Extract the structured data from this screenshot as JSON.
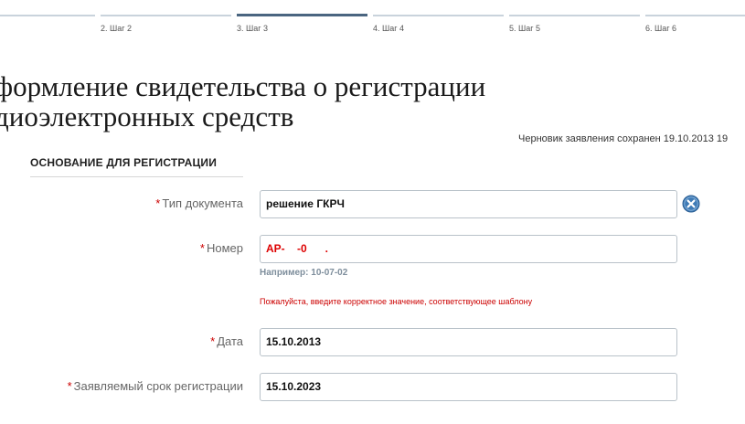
{
  "steps": [
    {
      "label": ""
    },
    {
      "label": "2. Шаг 2"
    },
    {
      "label": "3. Шаг 3"
    },
    {
      "label": "4. Шаг 4"
    },
    {
      "label": "5. Шаг 5"
    },
    {
      "label": "6. Шаг 6"
    }
  ],
  "active_step": 3,
  "page": {
    "title_line1": "формление свидетельства о регистрации",
    "title_line2": "диоэлектронных средств",
    "draft_status": "Черновик заявления сохранен 19.10.2013 19"
  },
  "section": {
    "title": "ОСНОВАНИЕ ДЛЯ РЕГИСТРАЦИИ"
  },
  "form": {
    "required_mark": "*",
    "doc_type": {
      "label": "Тип документа",
      "value": "решение ГКРЧ"
    },
    "number": {
      "label": "Номер",
      "value": "АР-    -0      .",
      "hint": "Например: 10-07-02",
      "error": "Пожалуйста, введите корректное значение, соответствующее шаблону"
    },
    "date": {
      "label": "Дата",
      "value": "15.10.2013"
    },
    "term": {
      "label": "Заявляемый срок регистрации",
      "value": "15.10.2023"
    }
  },
  "colors": {
    "accent": "#4a6580",
    "required": "#cc0000",
    "clear_button": "#3f7bb6"
  }
}
